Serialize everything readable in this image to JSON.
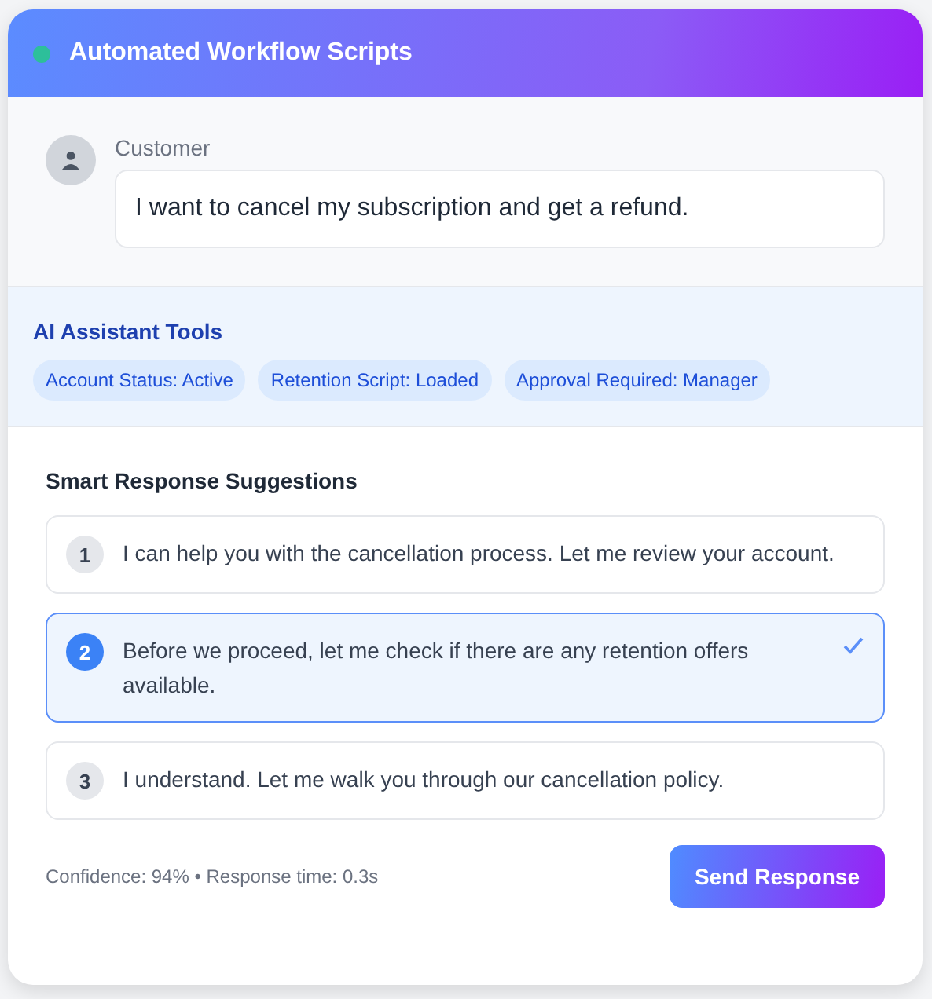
{
  "header": {
    "title": "Automated Workflow Scripts"
  },
  "customer": {
    "label": "Customer",
    "message": "I want to cancel my subscription and get a refund."
  },
  "tools": {
    "title": "AI Assistant Tools",
    "tags": [
      "Account Status: Active",
      "Retention Script: Loaded",
      "Approval Required: Manager"
    ]
  },
  "suggestions": {
    "title": "Smart Response Suggestions",
    "items": [
      {
        "number": "1",
        "text": "I can help you with the cancellation process. Let me review your account.",
        "selected": false
      },
      {
        "number": "2",
        "text": "Before we proceed, let me check if there are any retention offers available.",
        "selected": true
      },
      {
        "number": "3",
        "text": "I understand. Let me walk you through our cancellation policy.",
        "selected": false
      }
    ]
  },
  "footer": {
    "stats": "Confidence: 94% • Response time: 0.3s",
    "button": "Send Response"
  }
}
